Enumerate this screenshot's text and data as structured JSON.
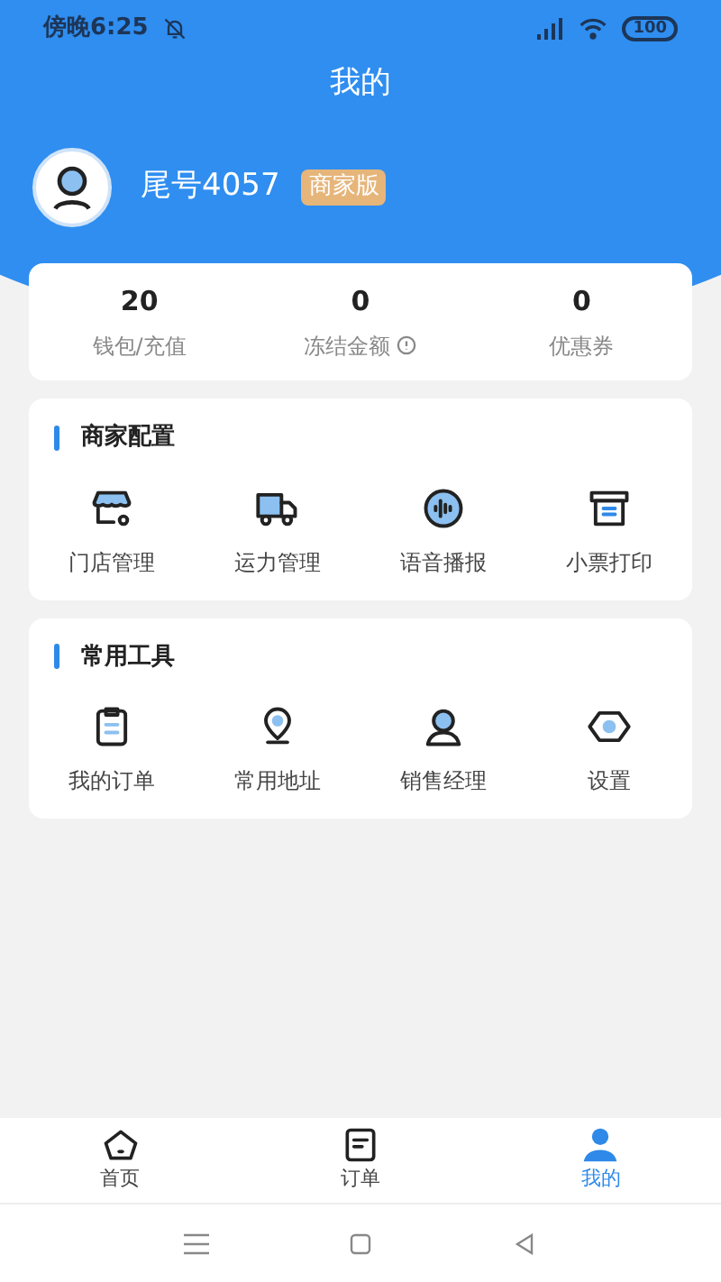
{
  "status_bar": {
    "time": "傍晚6:25",
    "battery": "100"
  },
  "title": "我的",
  "profile": {
    "name": "尾号4057",
    "badge": "商家版"
  },
  "stats": [
    {
      "value": "20",
      "label": "钱包/充值",
      "info": false
    },
    {
      "value": "0",
      "label": "冻结金额",
      "info": true
    },
    {
      "value": "0",
      "label": "优惠券",
      "info": false
    }
  ],
  "sections": [
    {
      "title": "商家配置",
      "items": [
        {
          "label": "门店管理",
          "kind": "store"
        },
        {
          "label": "运力管理",
          "kind": "truck"
        },
        {
          "label": "语音播报",
          "kind": "voice"
        },
        {
          "label": "小票打印",
          "kind": "printer"
        }
      ]
    },
    {
      "title": "常用工具",
      "items": [
        {
          "label": "我的订单",
          "kind": "clipboard"
        },
        {
          "label": "常用地址",
          "kind": "pin"
        },
        {
          "label": "销售经理",
          "kind": "person"
        },
        {
          "label": "设置",
          "kind": "hexagon"
        }
      ]
    }
  ],
  "tabs": [
    {
      "label": "首页",
      "kind": "home",
      "selected": false
    },
    {
      "label": "订单",
      "kind": "order",
      "selected": false
    },
    {
      "label": "我的",
      "kind": "user",
      "selected": true
    }
  ]
}
